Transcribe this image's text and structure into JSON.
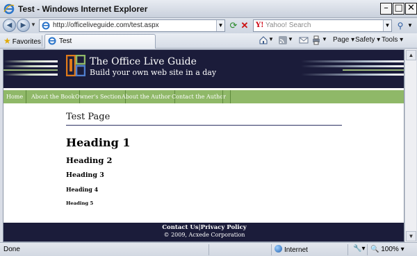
{
  "window": {
    "title": "Test - Windows Internet Explorer",
    "min_glyph": "–",
    "max_glyph": "□",
    "close_glyph": "✕"
  },
  "toolbar": {
    "url": "http://officeliveguide.com/test.aspx",
    "search_placeholder": "Yahoo! Search",
    "favorites_label": "Favorites",
    "tab_label": "Test",
    "page_menu": "Page",
    "safety_menu": "Safety",
    "tools_menu": "Tools"
  },
  "site": {
    "title": "The Office Live Guide",
    "tagline": "Build your own web site in a day",
    "nav": [
      "Home",
      "About the Book",
      "Owner's Section",
      "About the Author",
      "Contact the Author"
    ]
  },
  "page": {
    "title": "Test Page",
    "headings": [
      "Heading 1",
      "Heading 2",
      "Heading 3",
      "Heading 4",
      "Heading 5"
    ]
  },
  "footer": {
    "links": "Contact Us|Privacy Policy",
    "copyright": "© 2009, Acxede Corporation"
  },
  "status": {
    "text": "Done",
    "zone": "Internet",
    "zoom": "100%"
  },
  "colors": {
    "header_bg": "#1b1c3a",
    "nav_bg": "#8fb868"
  }
}
